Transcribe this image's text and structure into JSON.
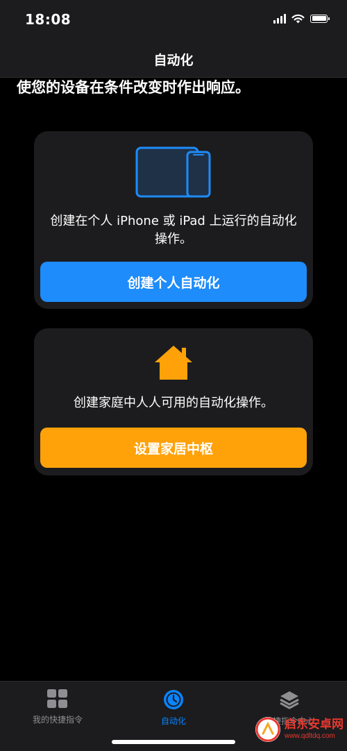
{
  "status_bar": {
    "time": "18:08"
  },
  "header": {
    "title": "自动化"
  },
  "subtitle": "使您的设备在条件改变时作出响应。",
  "cards": {
    "personal": {
      "icon": "iphone-ipad-icon",
      "description": "创建在个人 iPhone 或 iPad 上运行的自动化操作。",
      "button_label": "创建个人自动化",
      "button_color": "#1e8cfa"
    },
    "home": {
      "icon": "house-icon",
      "description": "创建家庭中人人可用的自动化操作。",
      "button_label": "设置家居中枢",
      "button_color": "#ffa20a"
    }
  },
  "tabs": [
    {
      "label": "我的快捷指令",
      "icon": "grid-icon",
      "active": false
    },
    {
      "label": "自动化",
      "icon": "clock-icon",
      "active": true
    },
    {
      "label": "快捷指令中心",
      "icon": "layers-icon",
      "active": false
    }
  ],
  "watermark": {
    "name": "启东安卓网",
    "url": "www.qdltdq.com"
  },
  "colors": {
    "accent_blue": "#0a84ff",
    "accent_orange": "#ffa20a",
    "card_bg": "#1c1c1e",
    "background": "#000000"
  }
}
